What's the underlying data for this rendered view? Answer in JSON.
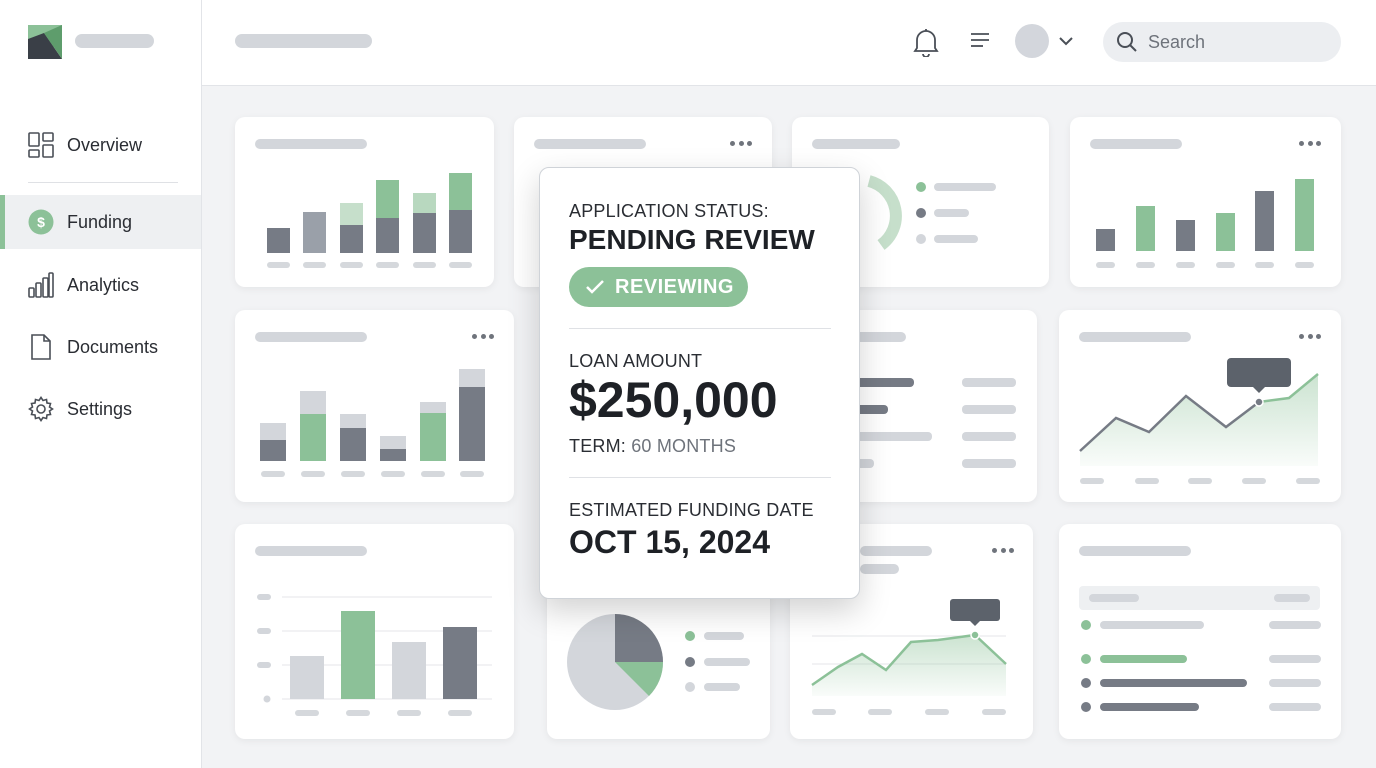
{
  "sidebar": {
    "items": [
      {
        "label": "Overview",
        "icon": "grid-icon"
      },
      {
        "label": "Funding",
        "icon": "dollar-icon"
      },
      {
        "label": "Analytics",
        "icon": "bar-chart-icon"
      },
      {
        "label": "Documents",
        "icon": "document-icon"
      },
      {
        "label": "Settings",
        "icon": "gear-icon"
      }
    ],
    "active": "Funding"
  },
  "header": {
    "search_placeholder": "Search",
    "icons": [
      "bell-icon",
      "menu-icon",
      "avatar",
      "chevron-down-icon",
      "search-icon"
    ]
  },
  "status_card": {
    "status_label": "APPLICATION STATUS:",
    "status_value": "PENDING REVIEW",
    "badge": "REVIEWING",
    "loan_label": "LOAN AMOUNT",
    "loan_amount": "$250,000",
    "term_label": "TERM:",
    "term_value": "60 MONTHS",
    "funding_label": "ESTIMATED FUNDING DATE",
    "funding_date": "OCT 15, 2024"
  },
  "colors": {
    "accent_green": "#8cc198",
    "dark_gray": "#767b85",
    "light_gray": "#d3d6db"
  }
}
